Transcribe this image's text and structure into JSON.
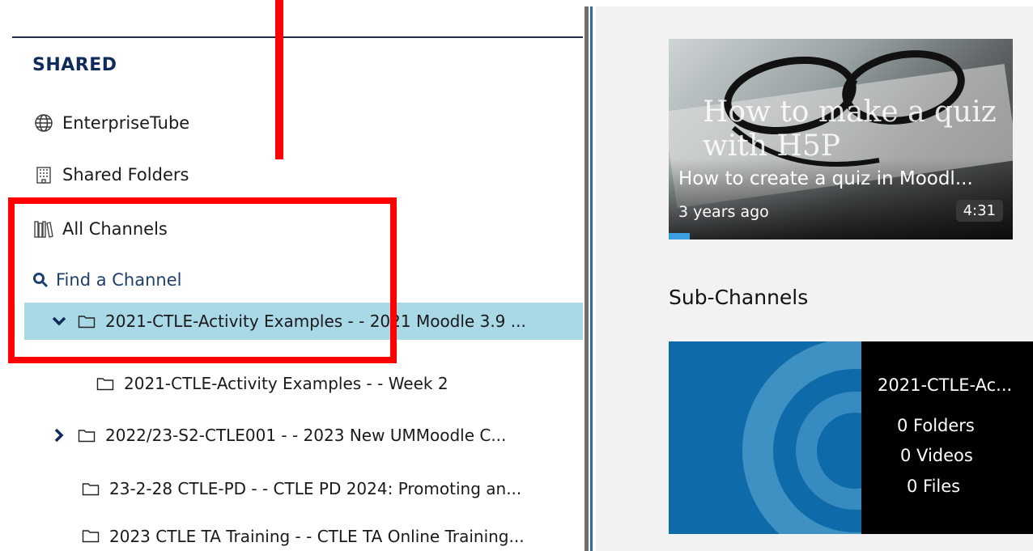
{
  "sidebar": {
    "heading": "SHARED",
    "items": [
      {
        "label": "EnterpriseTube",
        "icon": "globe-icon"
      },
      {
        "label": "Shared Folders",
        "icon": "building-icon"
      },
      {
        "label": "All Channels",
        "icon": "library-icon"
      },
      {
        "label": "Find a Channel",
        "icon": "search-icon"
      }
    ],
    "tree": [
      {
        "label": "2021-CTLE-Activity Examples - - 2021 Moodle 3.9 ...",
        "expanded": true,
        "selected": true
      },
      {
        "label": "2021-CTLE-Activity Examples - - Week 2",
        "indent": true
      },
      {
        "label": "2022/23-S2-CTLE001 - - 2023 New UMMoodle C...",
        "collapsed": true
      },
      {
        "label": "23-2-28 CTLE-PD - - CTLE PD 2024: Promoting an..."
      },
      {
        "label": "2023 CTLE TA Training - - CTLE TA Online Training..."
      }
    ]
  },
  "video": {
    "overlay_title": "How to make a quiz with H5P",
    "title": "How to create a quiz in Moodl...",
    "age": "3 years ago",
    "duration": "4:31",
    "progress_fraction": 0.06
  },
  "subchannels": {
    "heading": "Sub-Channels",
    "card": {
      "name": "2021-CTLE-Ac...",
      "folders": "0 Folders",
      "videos": "0 Videos",
      "files": "0 Files"
    }
  },
  "colors": {
    "heading": "#0f2b5b",
    "selected_row": "#a9d8e6",
    "annotation": "#ff0000",
    "channel_thumb": "#0e6aa8"
  }
}
